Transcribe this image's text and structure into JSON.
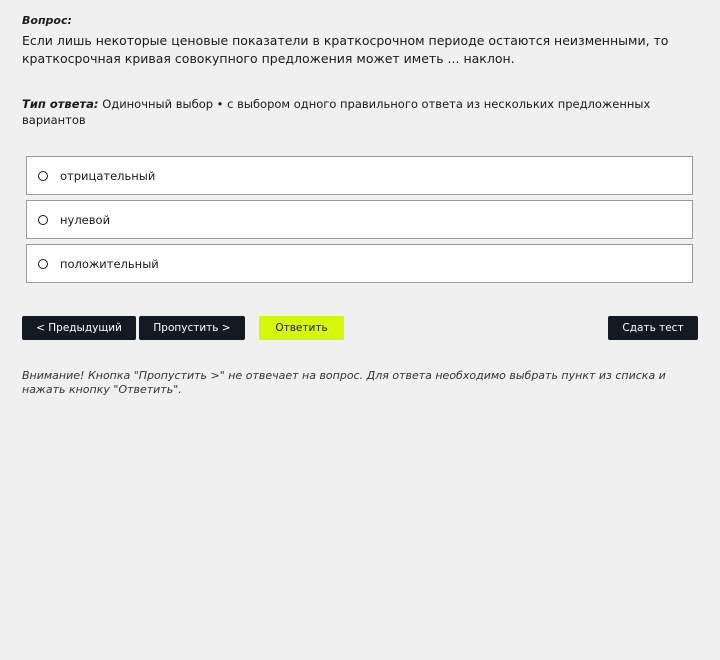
{
  "question": {
    "label": "Вопрос:",
    "text": "Если лишь некоторые ценовые показатели в краткосрочном периоде остаются неизменными, то краткосрочная кривая совокупного предложения может иметь ... наклон."
  },
  "answer_type": {
    "label": "Тип ответа:",
    "value": "Одиночный выбор • с выбором одного правильного ответа из нескольких предложенных вариантов"
  },
  "options": [
    {
      "label": "отрицательный",
      "icon": "radio-icon"
    },
    {
      "label": "нулевой",
      "icon": "radio-icon"
    },
    {
      "label": "положительный",
      "icon": "radio-icon"
    }
  ],
  "buttons": {
    "prev": "< Предыдущий",
    "skip": "Пропустить >",
    "answer": "Ответить",
    "submit": "Сдать тест"
  },
  "notice": "Внимание! Кнопка \"Пропустить >\" не отвечает на вопрос. Для ответа необходимо выбрать пункт из списка и нажать кнопку \"Ответить\".",
  "colors": {
    "background": "#f0f0f0",
    "dark_button": "#141a21",
    "accent_button": "#d4f70a",
    "option_border": "#9a9a9a"
  }
}
